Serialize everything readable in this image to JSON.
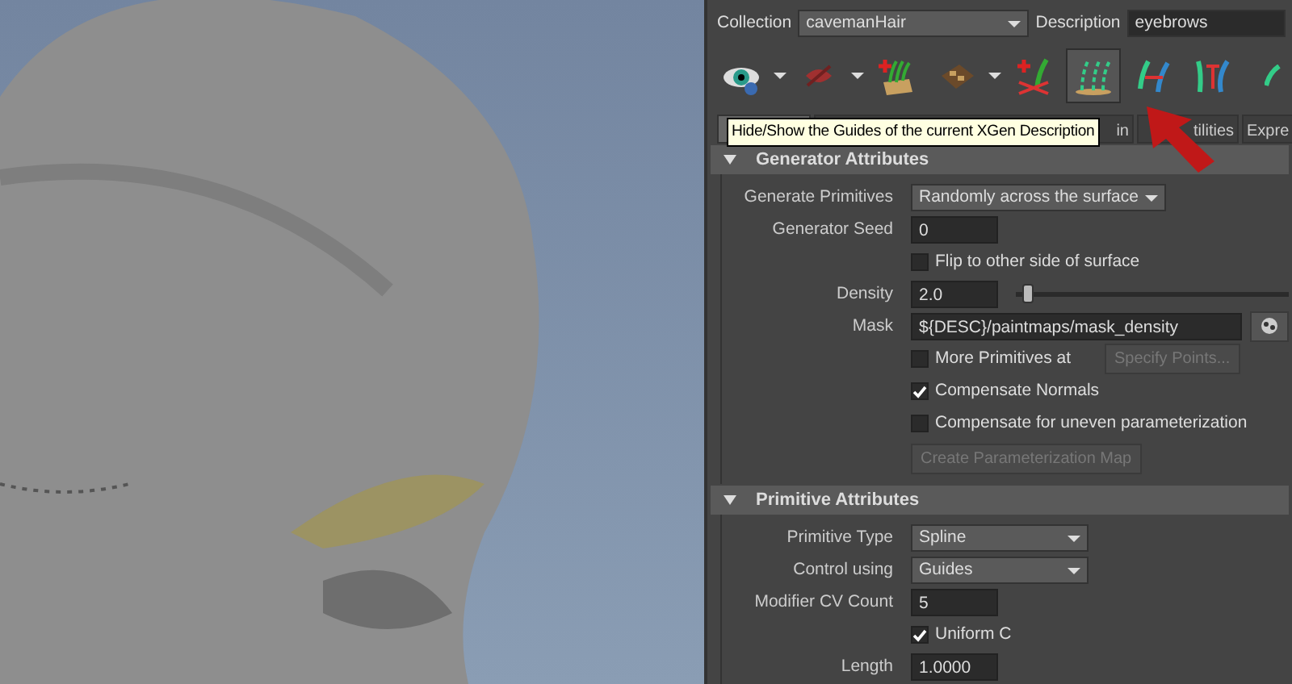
{
  "collection": {
    "label": "Collection",
    "value": "cavemanHair"
  },
  "description": {
    "label": "Description",
    "value": "eyebrows"
  },
  "toolbar": [
    {
      "kind": "eye",
      "dropdown": true,
      "selected": false
    },
    {
      "kind": "hidden",
      "dropdown": true,
      "selected": false
    },
    {
      "kind": "add-guides",
      "dropdown": false,
      "selected": false
    },
    {
      "kind": "tiles",
      "dropdown": true,
      "selected": false
    },
    {
      "kind": "remove-guides",
      "dropdown": false,
      "selected": false
    },
    {
      "kind": "guides",
      "dropdown": false,
      "selected": true
    },
    {
      "kind": "guides-link",
      "dropdown": false,
      "selected": false
    },
    {
      "kind": "guides-split",
      "dropdown": false,
      "selected": false
    },
    {
      "kind": "guide-tip",
      "dropdown": false,
      "selected": false
    }
  ],
  "tabs": [
    {
      "selected": true
    },
    {
      "label": "in",
      "selected": false
    },
    {
      "label": "tilities",
      "selected": false
    },
    {
      "label": "Expre",
      "selected": false
    }
  ],
  "tooltip": "Hide/Show the Guides of the current XGen Description",
  "sections": [
    {
      "title": "Generator Attributes",
      "expanded": true,
      "rows": [
        {
          "kind": "dropdown",
          "label": "Generate Primitives",
          "value": "Randomly across the surface"
        },
        {
          "kind": "field",
          "label": "Generator Seed",
          "value": "0"
        },
        {
          "kind": "checkbox",
          "text": "Flip to other side of surface",
          "checked": false
        },
        {
          "kind": "slider",
          "label": "Density",
          "value": "2.0",
          "level": 0.02
        },
        {
          "kind": "map",
          "label": "Mask",
          "value": "${DESC}/paintmaps/mask_density"
        },
        {
          "kind": "checkbox",
          "text": "More Primitives at",
          "checked": false,
          "button": "Specify Points...",
          "button_disabled": true
        },
        {
          "kind": "checkbox",
          "text": "Compensate Normals",
          "checked": true
        },
        {
          "kind": "checkbox",
          "text": "Compensate for uneven parameterization",
          "checked": false
        },
        {
          "kind": "button",
          "text": "Create Parameterization Map",
          "disabled": true
        }
      ]
    },
    {
      "title": "Primitive Attributes",
      "expanded": true,
      "rows": [
        {
          "kind": "dropdown",
          "label": "Primitive Type",
          "value": "Spline"
        },
        {
          "kind": "dropdown",
          "label": "Control using",
          "value": "Guides"
        },
        {
          "kind": "field",
          "label": "Modifier CV Count",
          "value": "5"
        },
        {
          "kind": "checkbox",
          "text": "Uniform C",
          "checked": true
        },
        {
          "kind": "field",
          "label": "Length",
          "value": "1.0000"
        }
      ]
    }
  ]
}
